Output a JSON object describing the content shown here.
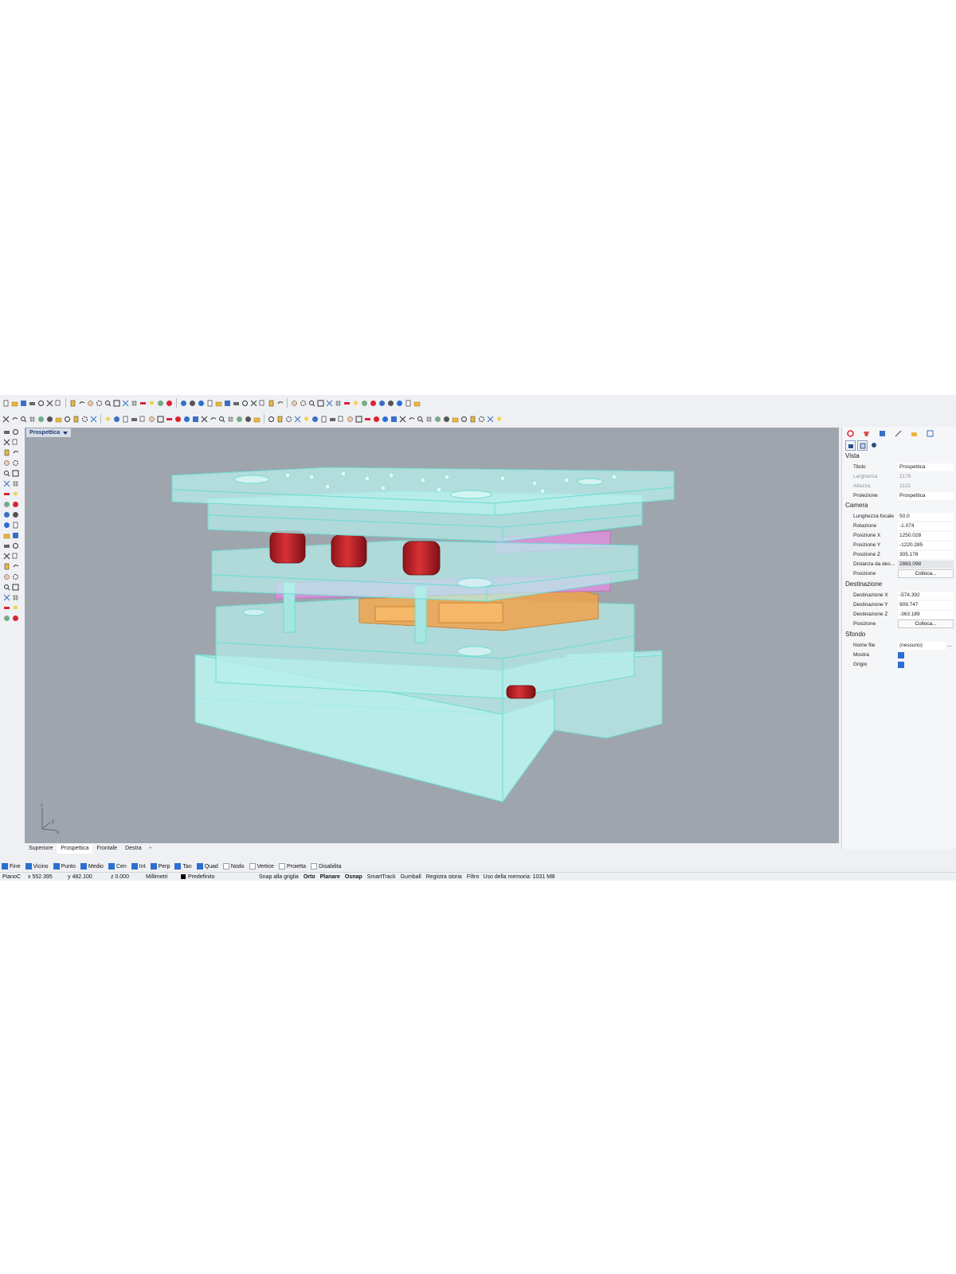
{
  "viewport": {
    "title": "Prospettica",
    "axis_labels": {
      "z": "z",
      "y": "y",
      "x": "x"
    },
    "tabs": [
      "Superiore",
      "Prospettica",
      "Frontale",
      "Destra"
    ],
    "active_tab": "Prospettica"
  },
  "panel": {
    "vista": {
      "heading": "Vista",
      "rows": [
        {
          "label": "Titolo",
          "value": "Prospettica"
        },
        {
          "label": "Larghezza",
          "value": "2176"
        },
        {
          "label": "Altezza",
          "value": "1122"
        },
        {
          "label": "Proiezione",
          "value": "Prospettica"
        }
      ]
    },
    "camera": {
      "heading": "Camera",
      "rows": [
        {
          "label": "Lunghezza focale",
          "value": "50.0"
        },
        {
          "label": "Rotazione",
          "value": "-1.074"
        },
        {
          "label": "Posizione X",
          "value": "1250.028"
        },
        {
          "label": "Posizione Y",
          "value": "-1220.285"
        },
        {
          "label": "Posizione Z",
          "value": "305.178"
        },
        {
          "label": "Distanza da des...",
          "value": "2883.098"
        },
        {
          "label": "Posizione",
          "value": "Colloca..."
        }
      ]
    },
    "destinazione": {
      "heading": "Destinazione",
      "rows": [
        {
          "label": "Destinazione X",
          "value": "-574.392"
        },
        {
          "label": "Destinazione Y",
          "value": "909.747"
        },
        {
          "label": "Destinazione Z",
          "value": "-363.189"
        },
        {
          "label": "Posizione",
          "value": "Colloca..."
        }
      ]
    },
    "sfondo": {
      "heading": "Sfondo",
      "rows": [
        {
          "label": "Nome file",
          "value": "(nessuno)",
          "button": "..."
        },
        {
          "label": "Mostra",
          "checked": true
        },
        {
          "label": "Grigio",
          "checked": true
        }
      ]
    }
  },
  "osnap": [
    {
      "label": "Fine",
      "checked": true
    },
    {
      "label": "Vicino",
      "checked": true
    },
    {
      "label": "Punto",
      "checked": true
    },
    {
      "label": "Medio",
      "checked": true
    },
    {
      "label": "Cen",
      "checked": true
    },
    {
      "label": "Int",
      "checked": true
    },
    {
      "label": "Perp",
      "checked": true
    },
    {
      "label": "Tan",
      "checked": true
    },
    {
      "label": "Quad",
      "checked": true
    },
    {
      "label": "Nodo",
      "checked": false
    },
    {
      "label": "Vertice",
      "checked": false
    },
    {
      "label": "Proietta",
      "checked": false
    },
    {
      "label": "Disabilita",
      "checked": false
    }
  ],
  "status": {
    "cplane": "PianoC",
    "x": "x 552.395",
    "y": "y 482.100",
    "z": "z 0.000",
    "units": "Millimetri",
    "layer": "Predefinito",
    "toggles": [
      "Snap alla griglia",
      "Orto",
      "Planare",
      "Osnap",
      "SmartTrack",
      "Gumball",
      "Registra storia",
      "Filtro"
    ],
    "bold_toggles": [
      "Orto",
      "Planare",
      "Osnap"
    ],
    "memory": "Uso della memoria: 1031 MB"
  },
  "colors": {
    "viewport_bg": "#9ea5ad",
    "plate_fill": "#b8f0ec",
    "plate_edge": "#6fdcd3",
    "spring_red": "#c8252a",
    "cavity_pink": "#e58ee3",
    "core_orange": "#f0a24a",
    "accent_blue": "#2c6fd1"
  }
}
